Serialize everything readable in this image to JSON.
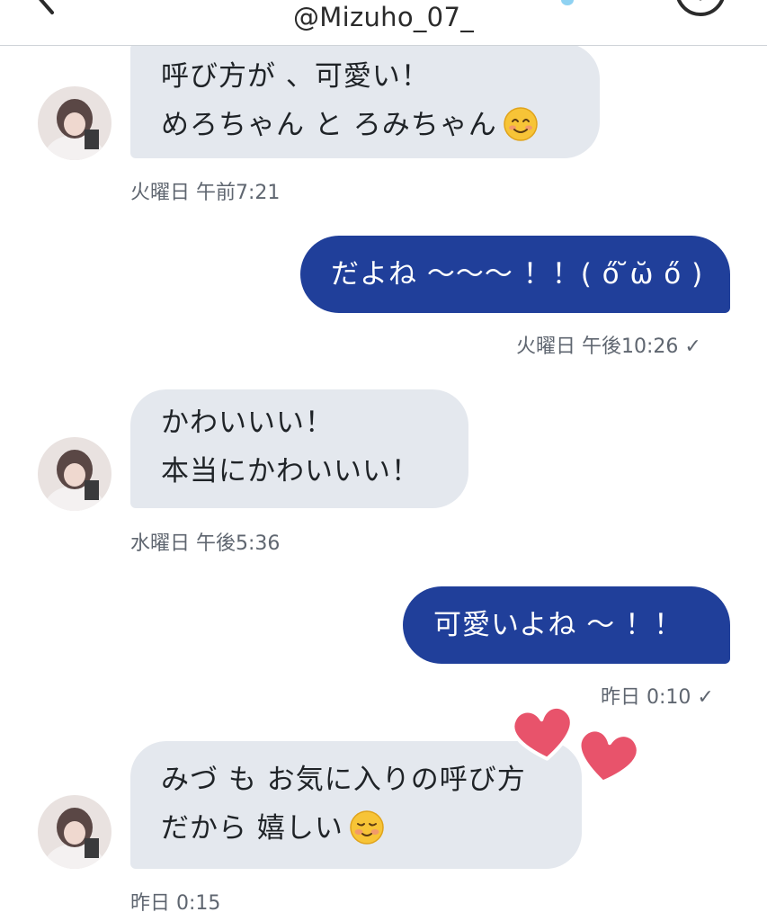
{
  "header": {
    "handle": "@Mizuho_07_",
    "back_icon": "chevron-left-icon",
    "info_icon": "info-circle-icon"
  },
  "colors": {
    "incoming_bubble": "#e4e8ee",
    "outgoing_bubble": "#203f9a",
    "heart": "#e8536b",
    "timestamp": "#5f6670"
  },
  "messages": [
    {
      "direction": "in",
      "lines": [
        "呼び方が 、可愛い！",
        "めろちゃん と ろみちゃん"
      ],
      "emoji": "smiling-face-emoji",
      "timestamp": "火曜日 午前7:21"
    },
    {
      "direction": "out",
      "lines": [
        "だよね 〜〜〜 ！！( ő ̆ω̆ ő )"
      ],
      "timestamp": "火曜日 午後10:26 ✓"
    },
    {
      "direction": "in",
      "lines": [
        "かわいいい！",
        "本当にかわいいい！"
      ],
      "timestamp": "水曜日 午後5:36"
    },
    {
      "direction": "out",
      "lines": [
        "可愛いよね 〜 ！！"
      ],
      "timestamp": "昨日 0:10 ✓"
    },
    {
      "direction": "in",
      "lines": [
        "みづ も お気に入りの呼び方",
        "だから 嬉しい"
      ],
      "emoji": "relieved-smiling-face-emoji",
      "timestamp": "昨日 0:15"
    }
  ],
  "decoration": {
    "stickers": "two-pink-hearts-icon"
  }
}
